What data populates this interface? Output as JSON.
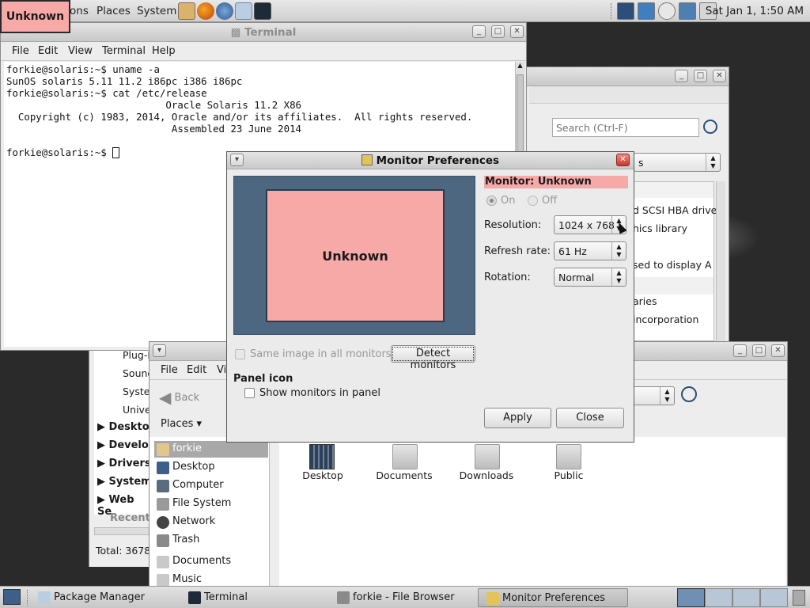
{
  "top_panel": {
    "menus": [
      "ons",
      "Places",
      "System"
    ],
    "clock": "Sat Jan  1,  1:50 AM",
    "unknown_tag": "Unknown"
  },
  "terminal": {
    "title": "Terminal",
    "menu": [
      "File",
      "Edit",
      "View",
      "Terminal",
      "Help"
    ],
    "content": "forkie@solaris:~$ uname -a\nSunOS solaris 5.11 11.2 i86pc i386 i86pc\nforkie@solaris:~$ cat /etc/release\n                           Oracle Solaris 11.2 X86\n  Copyright (c) 1983, 2014, Oracle and/or its affiliates.  All rights reserved.\n                            Assembled 23 June 2014\n\nforkie@solaris:~$ "
  },
  "package_manager": {
    "search_placeholder": "Search (Ctrl-F)",
    "combo_tail": "s",
    "rows": [
      "d SCSI HBA drive",
      "hics library",
      "",
      "sed to display A",
      "",
      "aries",
      "incorporation"
    ],
    "tree": [
      "Plug-I",
      "Sound",
      "Syste",
      "Unive"
    ],
    "groups": [
      "Deskto",
      "Develo",
      "Drivers",
      "System",
      "Web Se"
    ],
    "recent": "Recent",
    "total": "Total: 3678"
  },
  "file_browser": {
    "menu": [
      "File",
      "Edit",
      "View"
    ],
    "back": "Back",
    "places": "Places",
    "sidebar": [
      "forkie",
      "Desktop",
      "Computer",
      "File System",
      "Network",
      "Trash",
      "Documents",
      "Music"
    ],
    "files": [
      "Desktop",
      "Documents",
      "Downloads",
      "Public"
    ]
  },
  "monitor_dialog": {
    "title": "Monitor Preferences",
    "monitor_name": "Unknown",
    "monitor_heading": "Monitor: Unknown",
    "on_label": "On",
    "off_label": "Off",
    "resolution_label": "Resolution:",
    "resolution_value": "1024 x 768",
    "refresh_label": "Refresh rate:",
    "refresh_value": "61 Hz",
    "rotation_label": "Rotation:",
    "rotation_value": "Normal",
    "same_image_label": "Same image in all monitors",
    "detect_label": "Detect monitors",
    "panel_icon_heading": "Panel icon",
    "show_monitors_label": "Show monitors in panel",
    "apply_label": "Apply",
    "close_label": "Close"
  },
  "taskbar": {
    "tasks": [
      "Package Manager",
      "Terminal",
      "forkie - File Browser",
      "Monitor Preferences"
    ]
  }
}
